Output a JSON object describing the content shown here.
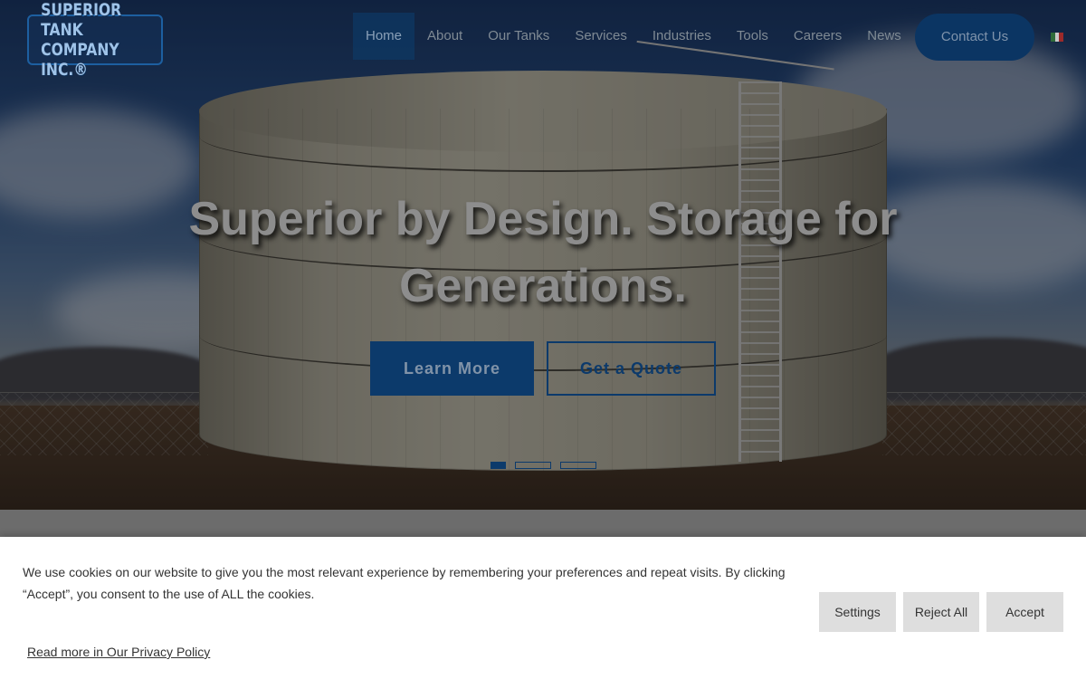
{
  "header": {
    "logo_line1": "SUPERIOR TANK",
    "logo_line2": "COMPANY INC.®",
    "nav": [
      {
        "label": "Home",
        "active": true
      },
      {
        "label": "About"
      },
      {
        "label": "Our Tanks"
      },
      {
        "label": "Services"
      },
      {
        "label": "Industries"
      },
      {
        "label": "Tools"
      },
      {
        "label": "Careers"
      },
      {
        "label": "News"
      }
    ],
    "contact_label": "Contact Us",
    "language_flag": "mexico-flag-icon"
  },
  "hero": {
    "headline_line1": "Superior by Design. Storage for",
    "headline_line2": "Generations.",
    "primary_button": "Learn More",
    "secondary_button": "Get a Quote",
    "slides": 3,
    "active_slide": 1
  },
  "cookie_banner": {
    "message_line1": "We use cookies on our website to give you the most relevant experience by remembering your preferences and repeat visits. By clicking",
    "message_line2": "“Accept”, you consent to the use of ALL the cookies.",
    "privacy_link": "Read more in Our Privacy Policy",
    "settings_label": "Settings",
    "reject_label": "Reject All",
    "accept_label": "Accept"
  },
  "colors": {
    "brand_blue": "#0c3a6b",
    "overlay": "#000000",
    "banner_bg": "#ffffff",
    "button_gray": "#dedede"
  }
}
